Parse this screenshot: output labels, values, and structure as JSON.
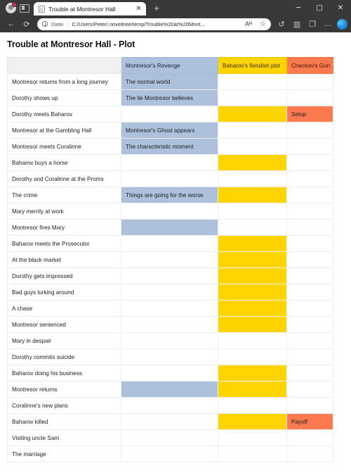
{
  "browser": {
    "tab": {
      "title": "Trouble at Montresor Hall",
      "close_label": "✕",
      "favicon": "document-icon"
    },
    "new_tab_label": "+",
    "window_controls": {
      "minimize": "─",
      "maximize": "□",
      "close": "✕"
    },
    "nav": {
      "back": "←",
      "reload": "⟳"
    },
    "omnibox": {
      "scheme_label": "Datei",
      "separator": "|",
      "url": "C:/Users/Peter/.noveltree/temp/Trouble%20at%20Mont…",
      "read_aloud": "Aᴺ",
      "favorite": "☆"
    },
    "toolbar_icons": {
      "history": "↺",
      "split_screen": "▥",
      "collections": "❐",
      "settings_more": "…",
      "copilot": "copilot-icon"
    }
  },
  "page": {
    "title": "Trouble at Montresor Hall - Plot"
  },
  "table": {
    "columns": [
      {
        "label": "",
        "style": "blank"
      },
      {
        "label": "Montresor's Revenge",
        "style": "blue"
      },
      {
        "label": "Baharov's fiendish plot",
        "style": "yellow"
      },
      {
        "label": "Checkov's Gun",
        "style": "orange"
      }
    ],
    "rows": [
      {
        "title": "Montresor returns from a long journey",
        "cells": [
          {
            "text": "The normal world",
            "style": "blue"
          },
          {
            "text": "",
            "style": "empty"
          },
          {
            "text": "",
            "style": "empty"
          }
        ]
      },
      {
        "title": "Dorothy shows up",
        "cells": [
          {
            "text": "The lie Montresor believes",
            "style": "blue"
          },
          {
            "text": "",
            "style": "empty"
          },
          {
            "text": "",
            "style": "empty"
          }
        ]
      },
      {
        "title": "Dorothy meets Baharov",
        "cells": [
          {
            "text": "",
            "style": "empty"
          },
          {
            "text": "",
            "style": "yellow"
          },
          {
            "text": "Setup",
            "style": "orange"
          }
        ]
      },
      {
        "title": "Montresor at the Gambling Hall",
        "cells": [
          {
            "text": "Montresor's Ghost appears",
            "style": "blue"
          },
          {
            "text": "",
            "style": "empty"
          },
          {
            "text": "",
            "style": "empty"
          }
        ]
      },
      {
        "title": "Montresor meets Coralinne",
        "cells": [
          {
            "text": "The characteristic moment",
            "style": "blue"
          },
          {
            "text": "",
            "style": "empty"
          },
          {
            "text": "",
            "style": "empty"
          }
        ]
      },
      {
        "title": "Baharov buys a horse",
        "cells": [
          {
            "text": "",
            "style": "empty"
          },
          {
            "text": "",
            "style": "yellow"
          },
          {
            "text": "",
            "style": "empty"
          }
        ]
      },
      {
        "title": "Dorothy and Coralinne at the Proms",
        "cells": [
          {
            "text": "",
            "style": "empty"
          },
          {
            "text": "",
            "style": "empty"
          },
          {
            "text": "",
            "style": "empty"
          }
        ]
      },
      {
        "title": "The crime",
        "cells": [
          {
            "text": "Things are going for the worse",
            "style": "blue"
          },
          {
            "text": "",
            "style": "yellow"
          },
          {
            "text": "",
            "style": "empty"
          }
        ]
      },
      {
        "title": "Mary merrily at work",
        "cells": [
          {
            "text": "",
            "style": "empty"
          },
          {
            "text": "",
            "style": "empty"
          },
          {
            "text": "",
            "style": "empty"
          }
        ]
      },
      {
        "title": "Montresor fires Mary",
        "cells": [
          {
            "text": "",
            "style": "blue"
          },
          {
            "text": "",
            "style": "empty"
          },
          {
            "text": "",
            "style": "empty"
          }
        ]
      },
      {
        "title": "Baharov meets the Prosecutor",
        "cells": [
          {
            "text": "",
            "style": "empty"
          },
          {
            "text": "",
            "style": "yellow"
          },
          {
            "text": "",
            "style": "empty"
          }
        ]
      },
      {
        "title": "At the black market",
        "cells": [
          {
            "text": "",
            "style": "empty"
          },
          {
            "text": "",
            "style": "yellow"
          },
          {
            "text": "",
            "style": "empty"
          }
        ]
      },
      {
        "title": "Dorothy gets impressed",
        "cells": [
          {
            "text": "",
            "style": "empty"
          },
          {
            "text": "",
            "style": "yellow"
          },
          {
            "text": "",
            "style": "empty"
          }
        ]
      },
      {
        "title": "Bad guys lurking around",
        "cells": [
          {
            "text": "",
            "style": "empty"
          },
          {
            "text": "",
            "style": "yellow"
          },
          {
            "text": "",
            "style": "empty"
          }
        ]
      },
      {
        "title": "A chase",
        "cells": [
          {
            "text": "",
            "style": "empty"
          },
          {
            "text": "",
            "style": "yellow"
          },
          {
            "text": "",
            "style": "empty"
          }
        ]
      },
      {
        "title": "Montresor sentenced",
        "cells": [
          {
            "text": "",
            "style": "empty"
          },
          {
            "text": "",
            "style": "yellow"
          },
          {
            "text": "",
            "style": "empty"
          }
        ]
      },
      {
        "title": "Mary in despair",
        "cells": [
          {
            "text": "",
            "style": "empty"
          },
          {
            "text": "",
            "style": "empty"
          },
          {
            "text": "",
            "style": "empty"
          }
        ]
      },
      {
        "title": "Dorothy commits suicide",
        "cells": [
          {
            "text": "",
            "style": "empty"
          },
          {
            "text": "",
            "style": "empty"
          },
          {
            "text": "",
            "style": "empty"
          }
        ]
      },
      {
        "title": "Baharov doing his business",
        "cells": [
          {
            "text": "",
            "style": "empty"
          },
          {
            "text": "",
            "style": "yellow"
          },
          {
            "text": "",
            "style": "empty"
          }
        ]
      },
      {
        "title": "Montresor returns",
        "cells": [
          {
            "text": "",
            "style": "blue"
          },
          {
            "text": "",
            "style": "yellow"
          },
          {
            "text": "",
            "style": "empty"
          }
        ]
      },
      {
        "title": "Coralinne's new plans",
        "cells": [
          {
            "text": "",
            "style": "empty"
          },
          {
            "text": "",
            "style": "empty"
          },
          {
            "text": "",
            "style": "empty"
          }
        ]
      },
      {
        "title": "Baharov killed",
        "cells": [
          {
            "text": "",
            "style": "empty"
          },
          {
            "text": "",
            "style": "yellow"
          },
          {
            "text": "Payoff",
            "style": "orange"
          }
        ]
      },
      {
        "title": "Visiting uncle Sam",
        "cells": [
          {
            "text": "",
            "style": "empty"
          },
          {
            "text": "",
            "style": "empty"
          },
          {
            "text": "",
            "style": "empty"
          }
        ]
      },
      {
        "title": "The marriage",
        "cells": [
          {
            "text": "",
            "style": "empty"
          },
          {
            "text": "",
            "style": "empty"
          },
          {
            "text": "",
            "style": "empty"
          }
        ]
      }
    ]
  },
  "colors": {
    "arc_blue": "#adc0dc",
    "arc_yellow": "#ffd400",
    "arc_orange": "#fb7a4f",
    "chrome": "#383838"
  }
}
